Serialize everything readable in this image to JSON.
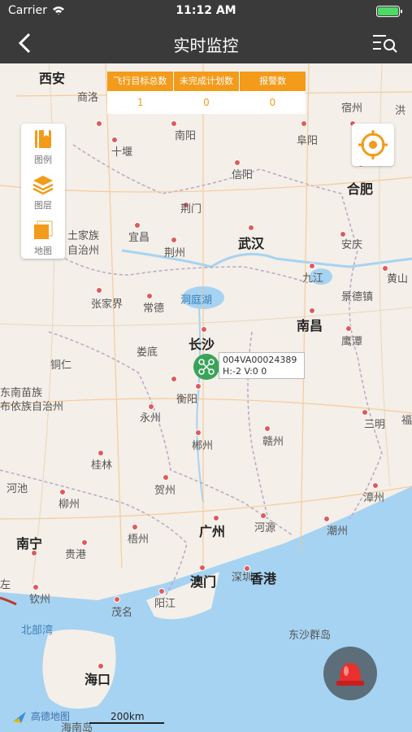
{
  "status_bar": {
    "carrier": "Carrier",
    "time": "11:12 AM"
  },
  "navbar": {
    "title": "实时监控"
  },
  "stats": {
    "headers": [
      "飞行目标总数",
      "未完成计划数",
      "报警数"
    ],
    "values": [
      "1",
      "0",
      "0"
    ]
  },
  "tools": [
    {
      "label": "图例",
      "icon": "legend-book-icon"
    },
    {
      "label": "图层",
      "icon": "layers-icon"
    },
    {
      "label": "地图",
      "icon": "map-square-icon"
    }
  ],
  "marker": {
    "id": "004VA00024389",
    "telemetry": "H:-2 V:0 0"
  },
  "map": {
    "cities": [
      {
        "name": "西安"
      },
      {
        "name": "商洛"
      },
      {
        "name": "南阳"
      },
      {
        "name": "阜阳"
      },
      {
        "name": "宿州"
      },
      {
        "name": "洪"
      },
      {
        "name": "十堰"
      },
      {
        "name": "信阳"
      },
      {
        "name": "合肥"
      },
      {
        "name": "荆门"
      },
      {
        "name": "土家族"
      },
      {
        "name": "自治州"
      },
      {
        "name": "宜昌"
      },
      {
        "name": "荆州"
      },
      {
        "name": "武汉"
      },
      {
        "name": "安庆"
      },
      {
        "name": "九江"
      },
      {
        "name": "黄山"
      },
      {
        "name": "张家界"
      },
      {
        "name": "常德"
      },
      {
        "name": "洞庭湖"
      },
      {
        "name": "景德镇"
      },
      {
        "name": "长沙"
      },
      {
        "name": "南昌"
      },
      {
        "name": "铜仁"
      },
      {
        "name": "娄底"
      },
      {
        "name": "鹰潭"
      },
      {
        "name": "东南苗族"
      },
      {
        "name": "布依族自治州"
      },
      {
        "name": "衡阳"
      },
      {
        "name": "永州"
      },
      {
        "name": "三明"
      },
      {
        "name": "福"
      },
      {
        "name": "郴州"
      },
      {
        "name": "赣州"
      },
      {
        "name": "桂林"
      },
      {
        "name": "河池"
      },
      {
        "name": "柳州"
      },
      {
        "name": "贺州"
      },
      {
        "name": "漳州"
      },
      {
        "name": "广州"
      },
      {
        "name": "河源"
      },
      {
        "name": "潮州"
      },
      {
        "name": "南宁"
      },
      {
        "name": "梧州"
      },
      {
        "name": "贵港"
      },
      {
        "name": "澳门"
      },
      {
        "name": "深圳"
      },
      {
        "name": "香港"
      },
      {
        "name": "钦州"
      },
      {
        "name": "茂名"
      },
      {
        "name": "阳江"
      },
      {
        "name": "北部湾"
      },
      {
        "name": "东沙群岛"
      },
      {
        "name": "海口"
      },
      {
        "name": "海南岛"
      },
      {
        "name": "左"
      }
    ],
    "scale": "200km",
    "provider": "高德地图"
  },
  "colors": {
    "bar": "#3a3a3a",
    "accent": "#f39b1a",
    "marker": "#3aa35a",
    "sea": "#a6d3f2"
  }
}
